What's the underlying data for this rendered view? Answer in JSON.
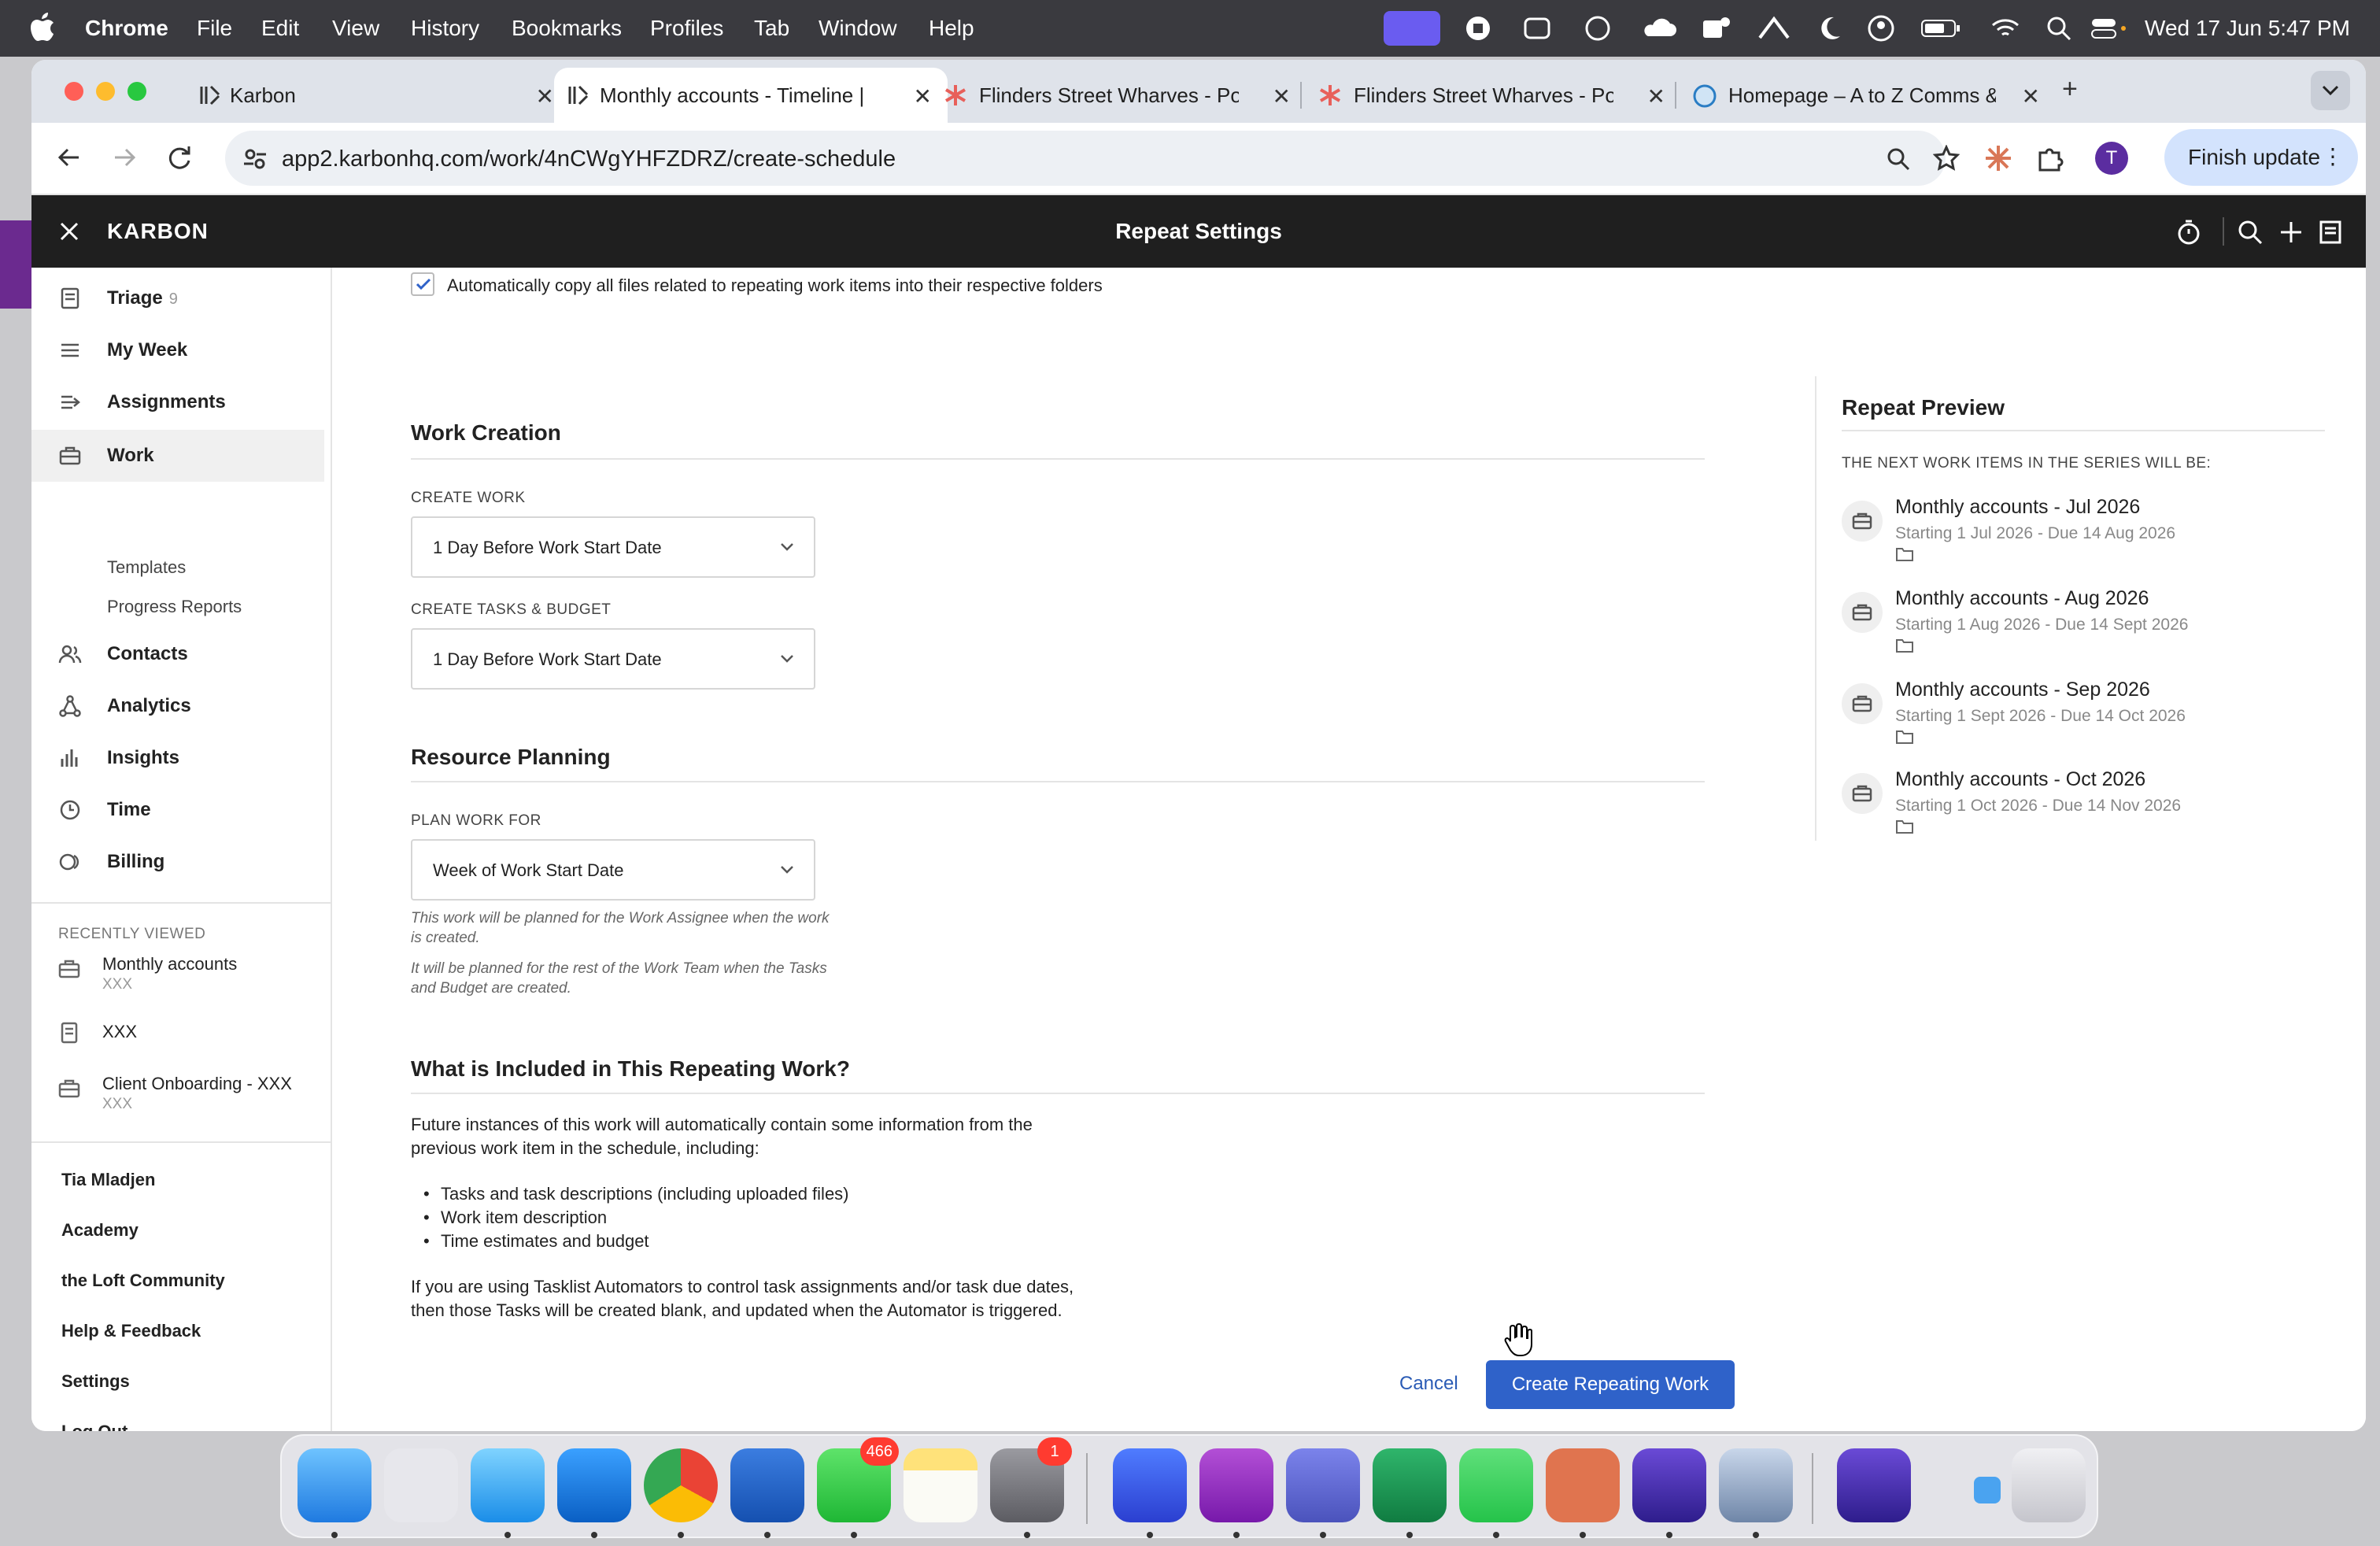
{
  "menubar": {
    "app_name": "Chrome",
    "items": [
      "File",
      "Edit",
      "View",
      "History",
      "Bookmarks",
      "Profiles",
      "Tab",
      "Window",
      "Help"
    ],
    "clock": "Wed 17 Jun  5:47 PM"
  },
  "browser": {
    "tabs": [
      {
        "title": "Karbon"
      },
      {
        "title": "Monthly accounts - Timeline |"
      },
      {
        "title": "Flinders Street Wharves - Pov"
      },
      {
        "title": "Flinders Street Wharves - Pov"
      },
      {
        "title": "Homepage – A to Z Comms &"
      }
    ],
    "new_tab_label": "+",
    "url": "app2.karbonhq.com/work/4nCWgYHFZDRZ/create-schedule",
    "profile_initial": "T",
    "finish_update_label": "Finish update"
  },
  "app": {
    "brand": "KARBON",
    "page_title": "Repeat Settings"
  },
  "sidebar": {
    "nav": [
      {
        "label": "Triage",
        "count": "9",
        "icon": "triage-icon"
      },
      {
        "label": "My Week",
        "icon": "list-icon"
      },
      {
        "label": "Assignments",
        "icon": "assignments-icon"
      },
      {
        "label": "Work",
        "icon": "briefcase-icon",
        "active": true
      },
      {
        "label": "Contacts",
        "icon": "contacts-icon"
      },
      {
        "label": "Analytics",
        "icon": "analytics-icon"
      },
      {
        "label": "Insights",
        "icon": "bar-chart-icon"
      },
      {
        "label": "Time",
        "icon": "clock-icon"
      },
      {
        "label": "Billing",
        "icon": "billing-icon"
      }
    ],
    "work_sub": [
      "Templates",
      "Progress Reports"
    ],
    "recently_viewed_heading": "RECENTLY VIEWED",
    "recent": [
      {
        "title": "Monthly accounts",
        "sub": "XXX"
      },
      {
        "title": "XXX",
        "sub": ""
      },
      {
        "title": "Client Onboarding - XXX",
        "sub": "XXX"
      }
    ],
    "bottom_links": [
      "Tia Mladjen",
      "Academy",
      "the Loft Community",
      "Help & Feedback",
      "Settings",
      "Log Out"
    ]
  },
  "form": {
    "copy_files_label": "Automatically copy all files related to repeating work items into their respective folders",
    "copy_files_checked": true,
    "work_creation": {
      "title": "Work Creation",
      "create_work_label": "CREATE WORK",
      "create_work_value": "1 Day Before Work Start Date",
      "create_tasks_label": "CREATE TASKS & BUDGET",
      "create_tasks_value": "1 Day Before Work Start Date"
    },
    "resource_planning": {
      "title": "Resource Planning",
      "plan_label": "PLAN WORK FOR",
      "plan_value": "Week of Work Start Date",
      "help_1": "This work will be planned for the Work Assignee when the work is created.",
      "help_2": "It will be planned for the rest of the Work Team when the Tasks and Budget are created."
    },
    "included": {
      "title": "What is Included in This Repeating Work?",
      "intro": "Future instances of this work will automatically contain some information from the previous work item in the schedule, including:",
      "bullets": [
        "Tasks and task descriptions (including uploaded files)",
        "Work item description",
        "Time estimates and budget"
      ],
      "note": "If you are using Tasklist Automators to control task assignments and/or task due dates, then those Tasks will be created blank, and updated when the Automator is triggered."
    },
    "cancel_label": "Cancel",
    "submit_label": "Create Repeating Work"
  },
  "preview": {
    "title": "Repeat Preview",
    "subtitle": "THE NEXT WORK ITEMS IN THE SERIES WILL BE:",
    "items": [
      {
        "title": "Monthly accounts - Jul 2026",
        "dates": "Starting 1 Jul 2026 - Due 14 Aug 2026"
      },
      {
        "title": "Monthly accounts - Aug 2026",
        "dates": "Starting 1 Aug 2026 - Due 14 Sept 2026"
      },
      {
        "title": "Monthly accounts - Sep 2026",
        "dates": "Starting 1 Sept 2026 - Due 14 Oct 2026"
      },
      {
        "title": "Monthly accounts - Oct 2026",
        "dates": "Starting 1 Oct 2026 - Due 14 Nov 2026"
      }
    ]
  },
  "dock": {
    "messages_badge": "466",
    "settings_badge": "1"
  }
}
